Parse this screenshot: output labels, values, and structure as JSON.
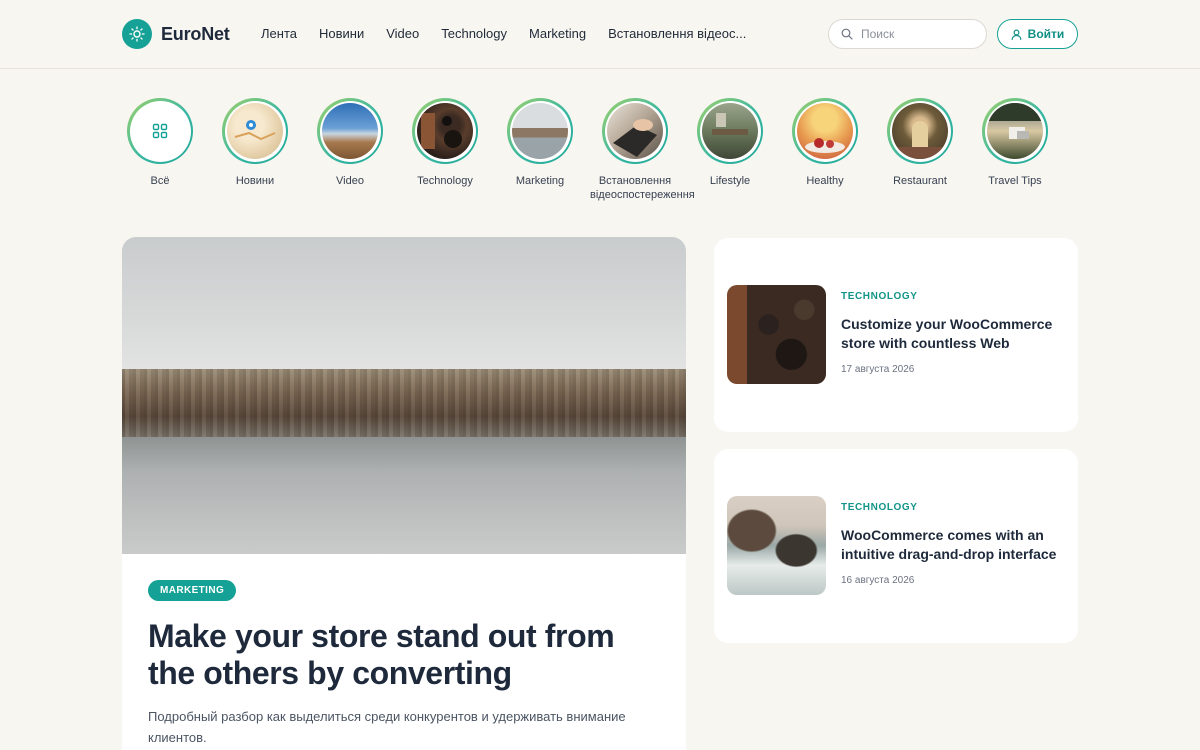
{
  "header": {
    "brand": "EuroNet",
    "nav": [
      "Лента",
      "Новини",
      "Video",
      "Technology",
      "Marketing",
      "Встановлення відеос..."
    ],
    "search_placeholder": "Поиск",
    "login_label": "Войти"
  },
  "categories": [
    {
      "label": "Всё",
      "icon": "grid-icon"
    },
    {
      "label": "Новини",
      "icon": "map-thumb"
    },
    {
      "label": "Video",
      "icon": "landscape-thumb"
    },
    {
      "label": "Technology",
      "icon": "desk-thumb"
    },
    {
      "label": "Marketing",
      "icon": "pier-thumb"
    },
    {
      "label": "Встановлення відеоспостереження",
      "icon": "typing-thumb"
    },
    {
      "label": "Lifestyle",
      "icon": "room-thumb"
    },
    {
      "label": "Healthy",
      "icon": "fruit-thumb"
    },
    {
      "label": "Restaurant",
      "icon": "tunnel-thumb"
    },
    {
      "label": "Travel Tips",
      "icon": "travel-thumb"
    }
  ],
  "featured": {
    "badge": "MARKETING",
    "title": "Make your store stand out from the others by converting",
    "description": "Подробный разбор как выделиться среди конкурентов и удерживать внимание клиентов."
  },
  "side_posts": [
    {
      "category": "TECHNOLOGY",
      "title": "Customize your WooCommerce store with countless Web",
      "date": "17 августа 2026"
    },
    {
      "category": "TECHNOLOGY",
      "title": "WooCommerce comes with an intuitive drag-and-drop interface",
      "date": "16 августа 2026"
    }
  ],
  "colors": {
    "accent": "#16a196",
    "background": "#f8f6f1",
    "title": "#1e2a3b"
  }
}
